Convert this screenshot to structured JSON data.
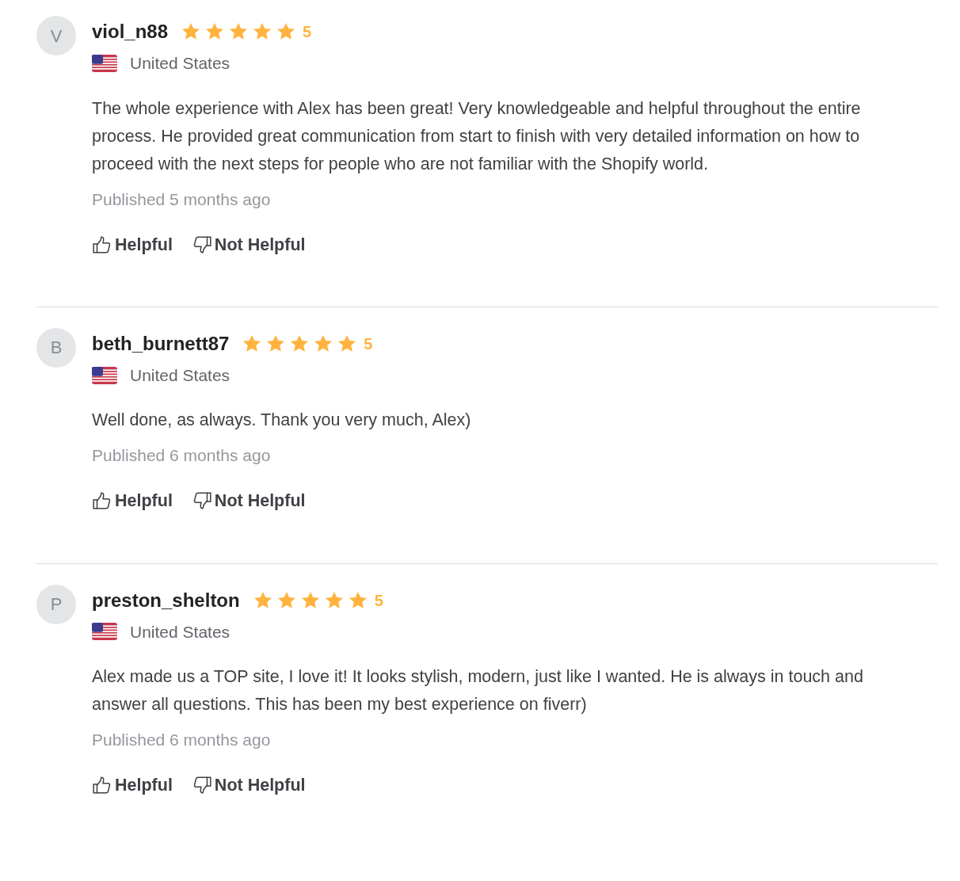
{
  "reviews": [
    {
      "avatar_letter": "V",
      "username": "viol_n88",
      "stars": 5,
      "rating": "5",
      "country": "United States",
      "text": "The whole experience with Alex has been great! Very knowledgeable and helpful throughout the entire process. He provided great communication from start to finish with very detailed information on how to proceed with the next steps for people who are not familiar with the Shopify world.",
      "published": "Published 5 months ago",
      "helpful": "Helpful",
      "not_helpful": "Not Helpful"
    },
    {
      "avatar_letter": "B",
      "username": "beth_burnett87",
      "stars": 5,
      "rating": "5",
      "country": "United States",
      "text": "Well done, as always. Thank you very much, Alex)",
      "published": "Published 6 months ago",
      "helpful": "Helpful",
      "not_helpful": "Not Helpful"
    },
    {
      "avatar_letter": "P",
      "username": "preston_shelton",
      "stars": 5,
      "rating": "5",
      "country": "United States",
      "text": "Alex made us a TOP site, I love it! It looks stylish, modern, just like I wanted. He is always in touch and answer all questions. This has been my best experience on fiverr)",
      "published": "Published 6 months ago",
      "helpful": "Helpful",
      "not_helpful": "Not Helpful"
    }
  ]
}
